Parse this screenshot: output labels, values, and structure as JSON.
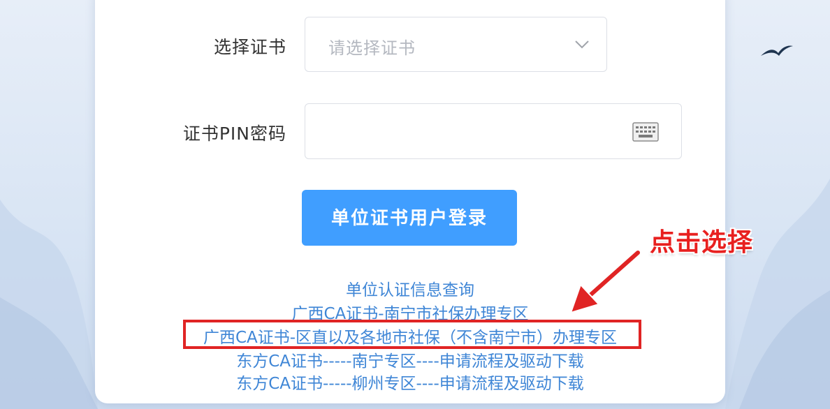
{
  "form": {
    "cert_label": "选择证书",
    "cert_placeholder": "请选择证书",
    "pin_label": "证书PIN密码",
    "pin_value": "",
    "login_button": "单位证书用户登录"
  },
  "links": [
    "单位认证信息查询",
    "广西CA证书-南宁市社保办理专区",
    "广西CA证书-区直以及各地市社保（不含南宁市）办理专区",
    "东方CA证书-----南宁专区----申请流程及驱动下载",
    "东方CA证书-----柳州专区----申请流程及驱动下载"
  ],
  "annotation": {
    "callout": "点击选择",
    "color": "#e02424"
  },
  "colors": {
    "primary": "#409eff",
    "link": "#3f86d6"
  },
  "icons": [
    "chevron-down-icon",
    "keyboard-icon",
    "bird-icon",
    "arrow-icon"
  ]
}
